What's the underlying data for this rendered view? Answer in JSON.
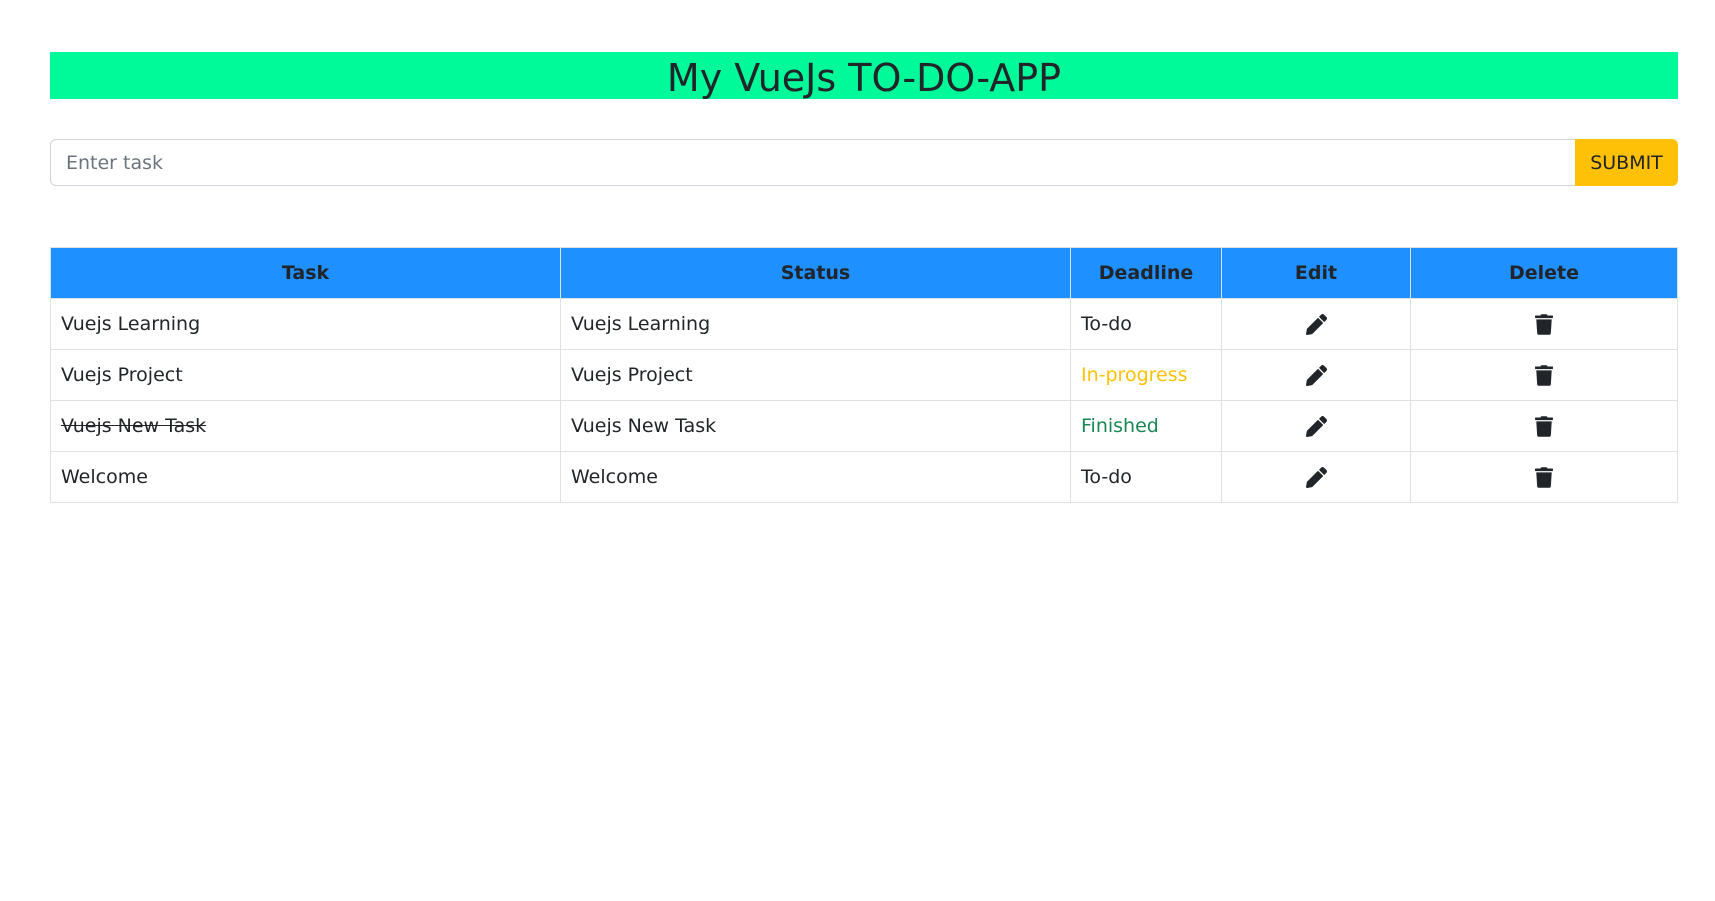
{
  "header": {
    "title": "My VueJs TO-DO-APP"
  },
  "form": {
    "input_placeholder": "Enter task",
    "input_value": "",
    "submit_label": "SUBMIT"
  },
  "table": {
    "columns": [
      "Task",
      "Status",
      "Deadline",
      "Edit",
      "Delete"
    ],
    "rows": [
      {
        "task": "Vuejs Learning",
        "status": "Vuejs Learning",
        "deadline": "To-do",
        "finished": false
      },
      {
        "task": "Vuejs Project",
        "status": "Vuejs Project",
        "deadline": "In-progress",
        "finished": false
      },
      {
        "task": "Vuejs New Task",
        "status": "Vuejs New Task",
        "deadline": "Finished",
        "finished": true
      },
      {
        "task": "Welcome",
        "status": "Welcome",
        "deadline": "To-do",
        "finished": false
      }
    ],
    "edit_icon": "pencil-icon",
    "delete_icon": "trash-icon"
  },
  "colors": {
    "header_bg": "#00fa9a",
    "table_header_bg": "#1e90ff",
    "submit_bg": "#ffc107",
    "in_progress": "#ffc107",
    "finished": "#198754"
  }
}
